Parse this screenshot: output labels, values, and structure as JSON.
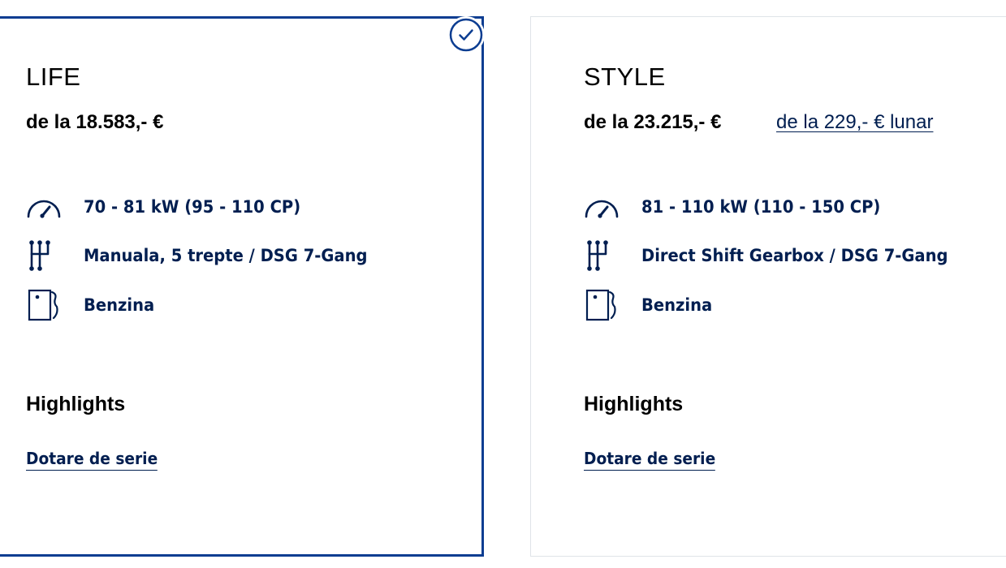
{
  "colors": {
    "selected_border": "#0c3d91",
    "text_primary": "#001e50",
    "text_black": "#000000",
    "card_border": "#dfe4e8"
  },
  "cards": [
    {
      "trim": "LIFE",
      "selected": true,
      "price": "de la 18.583,- €",
      "monthly": "",
      "specs": [
        {
          "icon": "speedometer-icon",
          "text": "70 - 81 kW (95 - 110 CP)"
        },
        {
          "icon": "gear-shift-icon",
          "text": "Manuala, 5 trepte / DSG 7-Gang"
        },
        {
          "icon": "fuel-pump-icon",
          "text": "Benzina"
        }
      ],
      "highlights_label": "Highlights",
      "link_label": "Dotare de serie"
    },
    {
      "trim": "STYLE",
      "selected": false,
      "price": "de la 23.215,- €",
      "monthly": "de la 229,- € lunar",
      "specs": [
        {
          "icon": "speedometer-icon",
          "text": "81 - 110 kW (110 - 150 CP)"
        },
        {
          "icon": "gear-shift-icon",
          "text": "Direct Shift Gearbox / DSG 7-Gang"
        },
        {
          "icon": "fuel-pump-icon",
          "text": "Benzina"
        }
      ],
      "highlights_label": "Highlights",
      "link_label": "Dotare de serie"
    }
  ]
}
